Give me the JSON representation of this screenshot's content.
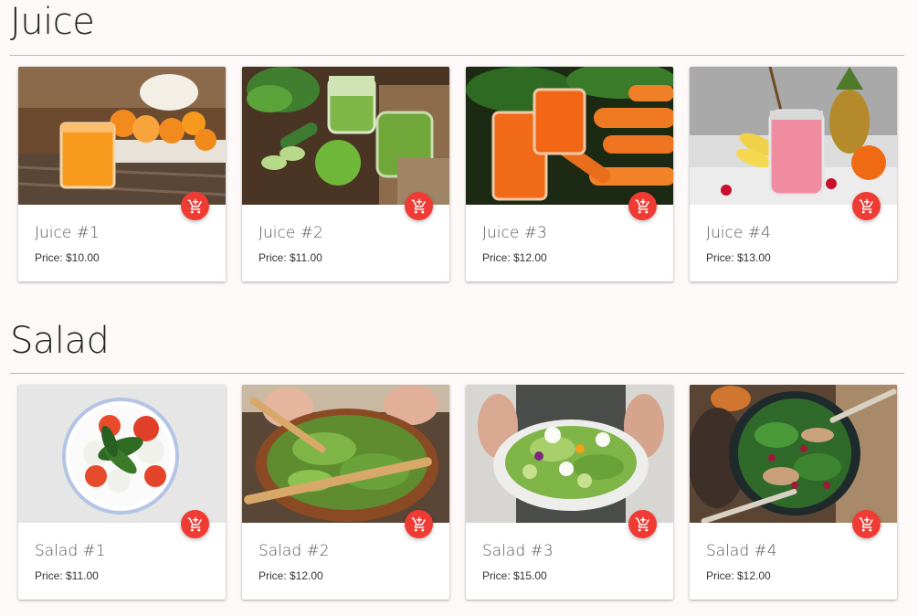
{
  "sections": [
    {
      "title": "Juice",
      "items": [
        {
          "name": "Juice #1",
          "price": "Price: $10.00"
        },
        {
          "name": "Juice #2",
          "price": "Price: $11.00"
        },
        {
          "name": "Juice #3",
          "price": "Price: $12.00"
        },
        {
          "name": "Juice #4",
          "price": "Price: $13.00"
        }
      ]
    },
    {
      "title": "Salad",
      "items": [
        {
          "name": "Salad #1",
          "price": "Price: $11.00"
        },
        {
          "name": "Salad #2",
          "price": "Price: $12.00"
        },
        {
          "name": "Salad #3",
          "price": "Price: $15.00"
        },
        {
          "name": "Salad #4",
          "price": "Price: $12.00"
        }
      ]
    }
  ],
  "icons": {
    "cart": "add-to-cart-icon"
  },
  "colors": {
    "cart_button": "#ef3b33",
    "background": "#fcf9f8"
  }
}
